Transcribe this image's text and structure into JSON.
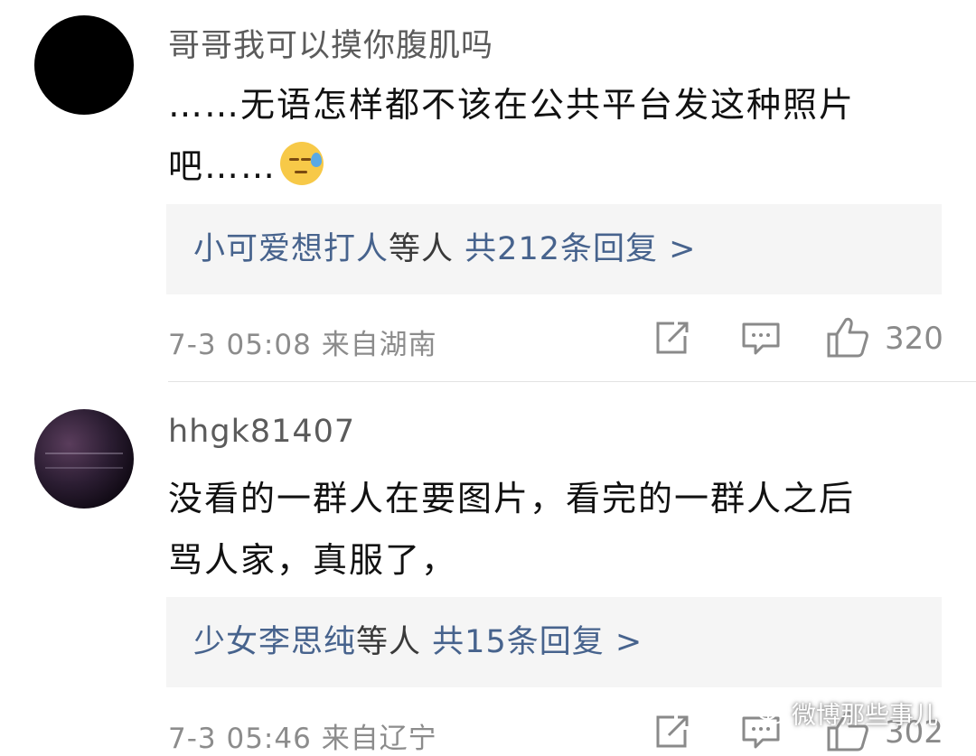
{
  "comments": [
    {
      "username": "哥哥我可以摸你腹肌吗",
      "text_line1": "……无语怎样都不该在公共平台发这种照片",
      "text_line2": "吧……",
      "emoji": "sweat-emoji",
      "reply_names": "小可爱想打人",
      "reply_suffix": "等人",
      "reply_count": "共212条回复 >",
      "time": "7-3 05:08",
      "location": "来自湖南",
      "likes": "320"
    },
    {
      "username": "hhgk81407",
      "text_line1": "没看的一群人在要图片，看完的一群人之后",
      "text_line2": "骂人家，真服了，",
      "reply_names": "少女李思纯",
      "reply_suffix": "等人",
      "reply_count": "共15条回复 >",
      "time": "7-3 05:46",
      "location": "来自辽宁",
      "likes": "302"
    }
  ],
  "watermark": "微博那些事儿",
  "icons": [
    "repost-icon",
    "comment-icon",
    "like-icon",
    "wechat-icon"
  ]
}
